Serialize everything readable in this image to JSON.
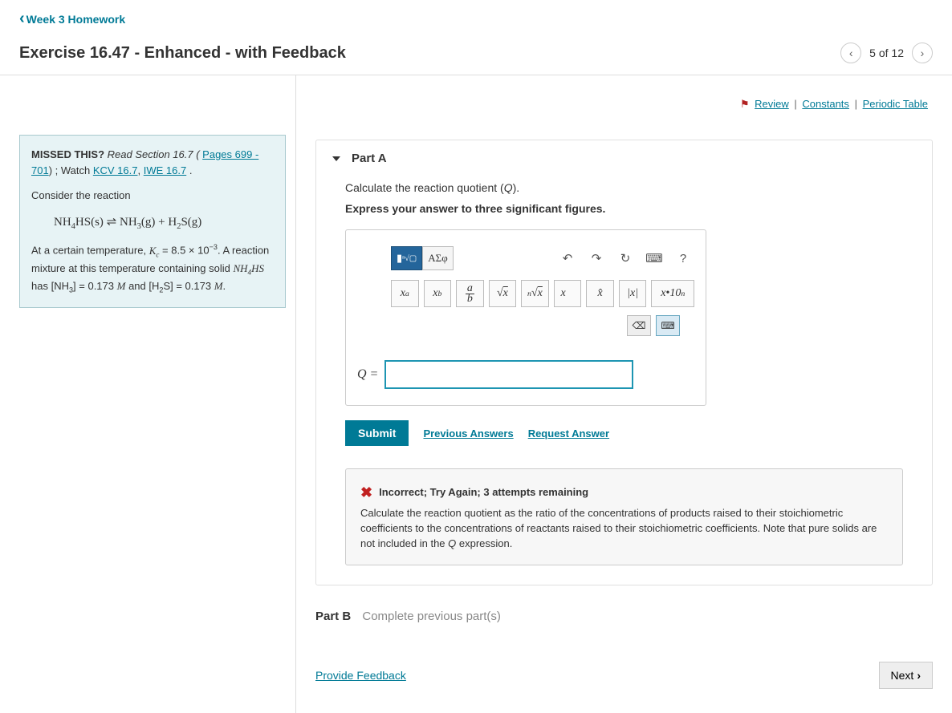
{
  "header": {
    "back_label": "Week 3 Homework",
    "title": "Exercise 16.47 - Enhanced - with Feedback",
    "pager": "5 of 12"
  },
  "top_links": {
    "review": "Review",
    "constants": "Constants",
    "periodic": "Periodic Table"
  },
  "hint": {
    "missed": "MISSED THIS?",
    "read": " Read Section 16.7 (",
    "pages_link": "Pages 699 - 701",
    "watch": ") ; Watch ",
    "kcv_link": "KCV 16.7",
    "iwe_link": "IWE 16.7",
    "consider": "Consider the reaction",
    "equation": "NH₄HS(s) ⇌ NH₃(g) + H₂S(g)",
    "text2a": "At a certain temperature, ",
    "kc": "Kc = 8.5 × 10⁻³",
    "text2b": ". A reaction mixture at this temperature containing solid ",
    "nh4hs": "NH₄HS",
    "has": " has ",
    "nh3": "[NH₃] = 0.173 M",
    "and": " and ",
    "h2s": "[H₂S] = 0.173 M",
    "period": "."
  },
  "part_a": {
    "label": "Part A",
    "prompt": "Calculate the reaction quotient (Q).",
    "instruction": "Express your answer to three significant figures.",
    "toolbar": {
      "greek": "ΑΣφ",
      "undo": "↶",
      "redo": "↷",
      "reset": "↻",
      "keyboard": "⌨",
      "help": "?"
    },
    "mathbtns": {
      "sup": "xᵃ",
      "sub": "xᵇ",
      "frac": "a/b",
      "sqrt": "√x",
      "nroot": "ⁿ√x",
      "vec": "x⃗",
      "hat": "x̂",
      "abs": "|x|",
      "sci": "x·10ⁿ"
    },
    "smallbtns": {
      "bksp": "⌫",
      "kbd2": "⌨"
    },
    "answer_label": "Q =",
    "answer_value": "",
    "submit": "Submit",
    "prev_answers": "Previous Answers",
    "request": "Request Answer"
  },
  "feedback": {
    "headline": "Incorrect; Try Again; 3 attempts remaining",
    "body": "Calculate the reaction quotient as the ratio of the concentrations of products raised to their stoichiometric coefficients to the concentrations of reactants raised to their stoichiometric coefficients. Note that pure solids are not included in the Q expression."
  },
  "part_b": {
    "label": "Part B",
    "msg": "Complete previous part(s)"
  },
  "footer": {
    "feedback_link": "Provide Feedback",
    "next": "Next"
  }
}
